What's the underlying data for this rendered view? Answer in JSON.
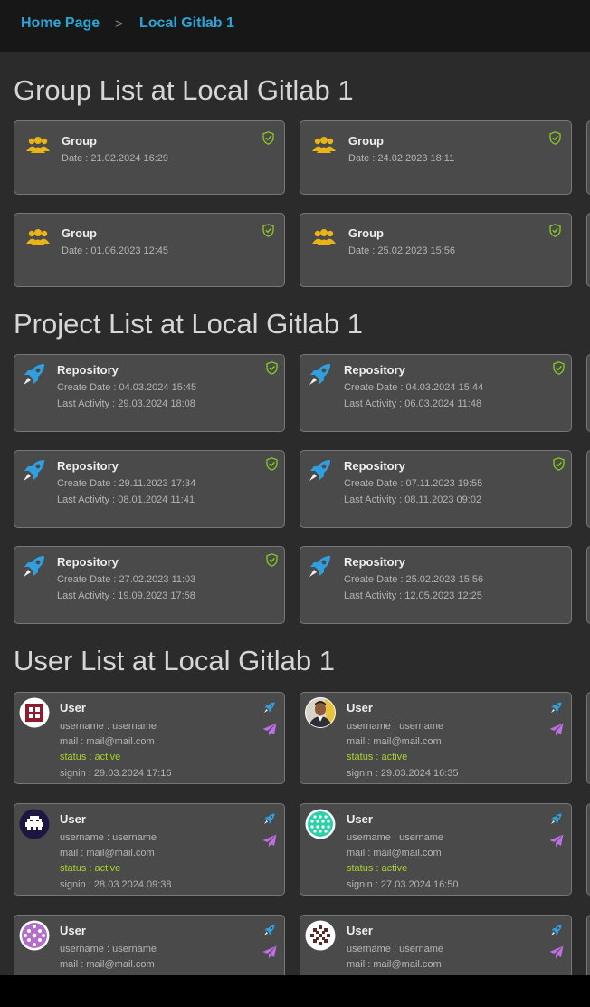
{
  "breadcrumb": {
    "home": "Home Page",
    "separator": ">",
    "current": "Local Gitlab 1"
  },
  "groups_section": {
    "title": "Group List at Local Gitlab 1",
    "items": [
      {
        "title": "Group",
        "date": "Date : 21.02.2024 16:29"
      },
      {
        "title": "Group",
        "date": "Date : 24.02.2023 18:11"
      },
      {
        "title": "Group",
        "date": "Date : 01.06.2023 12:45"
      },
      {
        "title": "Group",
        "date": "Date : 25.02.2023 15:56"
      }
    ]
  },
  "projects_section": {
    "title": "Project List at Local Gitlab 1",
    "items": [
      {
        "title": "Repository",
        "created": "Create Date : 04.03.2024 15:45",
        "activity": "Last Activity : 29.03.2024 18:08"
      },
      {
        "title": "Repository",
        "created": "Create Date : 04.03.2024 15:44",
        "activity": "Last Activity : 06.03.2024 11:48"
      },
      {
        "title": "Repository",
        "created": "Create Date : 29.11.2023 17:34",
        "activity": "Last Activity : 08.01.2024 11:41"
      },
      {
        "title": "Repository",
        "created": "Create Date : 07.11.2023 19:55",
        "activity": "Last Activity : 08.11.2023 09:02"
      },
      {
        "title": "Repository",
        "created": "Create Date : 27.02.2023 11:03",
        "activity": "Last Activity : 19.09.2023 17:58"
      },
      {
        "title": "Repository",
        "created": "Create Date : 25.02.2023 15:56",
        "activity": "Last Activity : 12.05.2023 12:25"
      }
    ]
  },
  "users_section": {
    "title": "User List at Local Gitlab 1",
    "items": [
      {
        "title": "User",
        "avatar": "red-grid-identicon",
        "username": "username : username",
        "mail": "mail : mail@mail.com",
        "status": "status : active",
        "signin": "signin : 29.03.2024 17:16"
      },
      {
        "title": "User",
        "avatar": "photo-avatar",
        "username": "username : username",
        "mail": "mail : mail@mail.com",
        "status": "status : active",
        "signin": "signin : 29.03.2024 16:35"
      },
      {
        "title": "User",
        "avatar": "space-invader-identicon",
        "username": "username : username",
        "mail": "mail : mail@mail.com",
        "status": "status : active",
        "signin": "signin : 28.03.2024 09:38"
      },
      {
        "title": "User",
        "avatar": "green-dots-identicon",
        "username": "username : username",
        "mail": "mail : mail@mail.com",
        "status": "status : active",
        "signin": "signin : 27.03.2024 16:50"
      },
      {
        "title": "User",
        "avatar": "purple-dots-identicon",
        "username": "username : username",
        "mail": "mail : mail@mail.com"
      },
      {
        "title": "User",
        "avatar": "pattern-identicon",
        "username": "username : username",
        "mail": "mail : mail@mail.com"
      }
    ]
  },
  "icons": {
    "group": "users-group-icon",
    "project": "rocket-icon",
    "verified": "shield-check-icon",
    "send": "paper-plane-icon"
  },
  "colors": {
    "accent": "#2aa6d6",
    "group_icon": "#e8b416",
    "verified": "#8ccc1e",
    "status_active": "#a6d22e",
    "send_icon": "#c06ee6",
    "card_bg": "#4a4a4a",
    "page_bg": "#2b2b2b"
  }
}
